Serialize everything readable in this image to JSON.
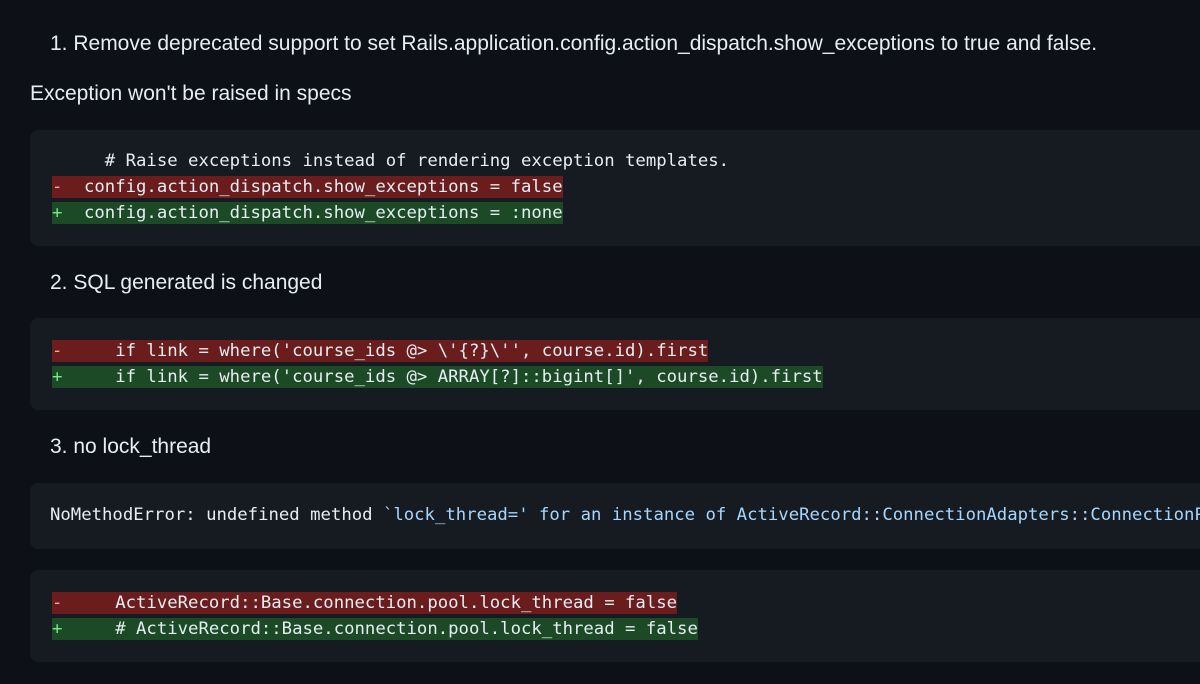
{
  "heading1": "1. Remove deprecated support to set Rails.application.config.action_dispatch.show_exceptions to true and false.",
  "note1": "Exception won't be raised in specs",
  "block1": {
    "context": "  # Raise exceptions instead of rendering exception templates.",
    "del_mark": "-",
    "del_code": "config.action_dispatch.show_exceptions = false",
    "add_mark": "+",
    "add_code": "config.action_dispatch.show_exceptions = :none"
  },
  "heading2": "2. SQL generated is changed",
  "block2": {
    "del_mark": "-",
    "del_code": "   if link = where('course_ids @> \\'{?}\\'', course.id).first",
    "add_mark": "+",
    "add_code": "   if link = where('course_ids @> ARRAY[?]::bigint[]', course.id).first"
  },
  "heading3": "3. no lock_thread",
  "block3": {
    "plain": "NoMethodError: undefined method ",
    "string": "`lock_thread=' for an instance of ActiveRecord::ConnectionAdapters::ConnectionPool"
  },
  "block4": {
    "del_mark": "-",
    "del_code": "   ActiveRecord::Base.connection.pool.lock_thread = false",
    "add_mark": "+",
    "add_code": "   # ActiveRecord::Base.connection.pool.lock_thread = false"
  }
}
